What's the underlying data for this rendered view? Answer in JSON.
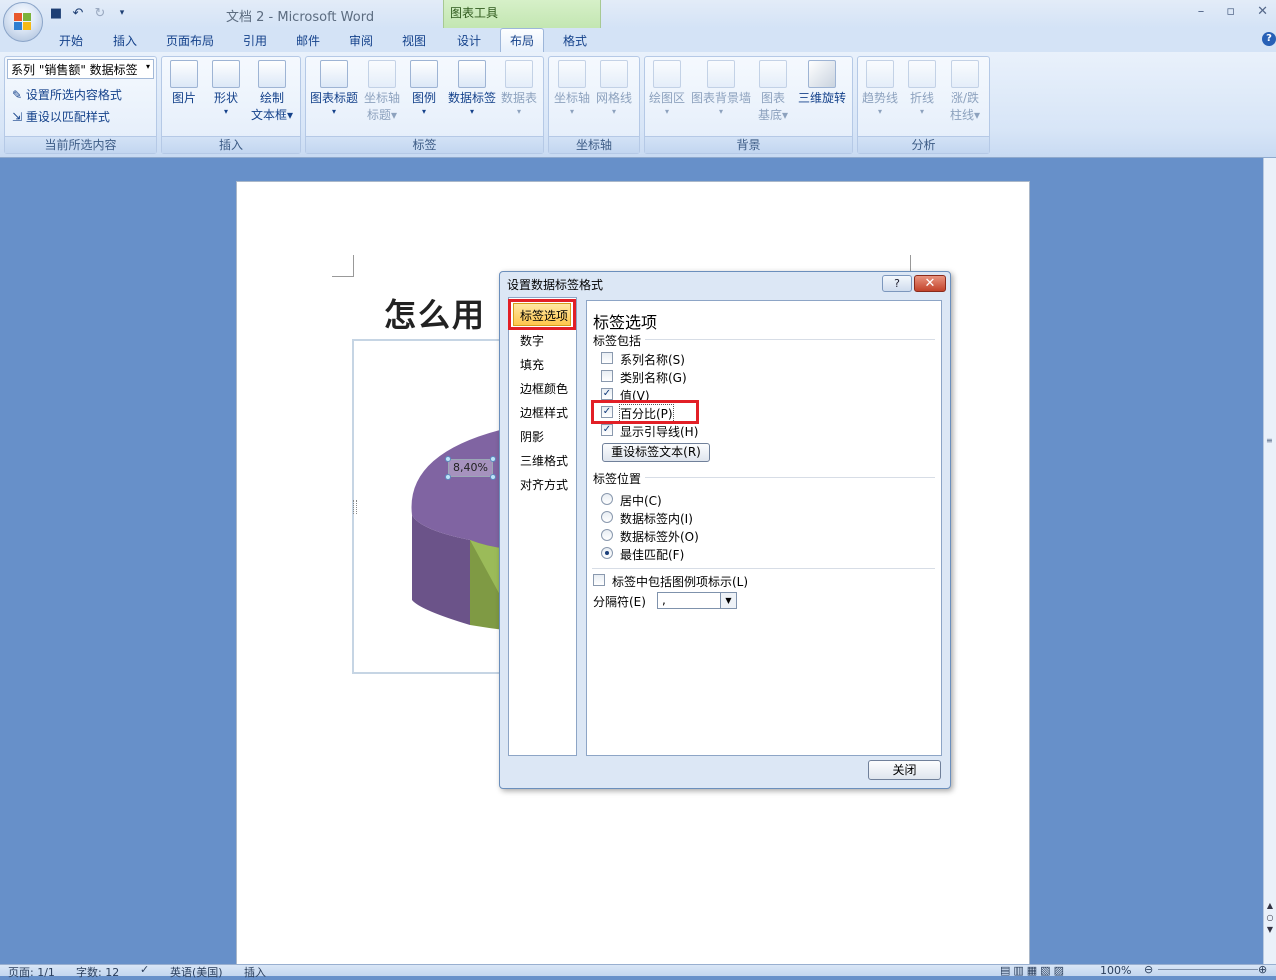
{
  "app": {
    "doc_title": "文档 2 - Microsoft Word",
    "contextual_tab": "图表工具"
  },
  "tabs": [
    "开始",
    "插入",
    "页面布局",
    "引用",
    "邮件",
    "审阅",
    "视图",
    "设计",
    "布局",
    "格式"
  ],
  "ribbon": {
    "current_selection": {
      "dropdown": "系列 \"销售额\" 数据标签",
      "format_sel": "设置所选内容格式",
      "reset": "重设以匹配样式",
      "label": "当前所选内容"
    },
    "insert": {
      "picture": "图片",
      "shapes": "形状",
      "textbox_1": "绘制",
      "textbox_2": "文本框",
      "label": "插入"
    },
    "labels": {
      "chart_title": "图表标题",
      "axis_title_1": "坐标轴",
      "axis_title_2": "标题",
      "legend": "图例",
      "data_labels": "数据标签",
      "data_table": "数据表",
      "label": "标签"
    },
    "axes": {
      "axes": "坐标轴",
      "gridlines": "网格线",
      "label": "坐标轴"
    },
    "background": {
      "plot_area": "绘图区",
      "wall": "图表背景墙",
      "floor_1": "图表",
      "floor_2": "基底",
      "rotation": "三维旋转",
      "label": "背景"
    },
    "analysis": {
      "trendline": "趋势线",
      "lines": "折线",
      "updown_1": "涨/跌",
      "updown_2": "柱线",
      "label": "分析"
    }
  },
  "document": {
    "heading": "怎么用",
    "data_label": "8,40%"
  },
  "dialog": {
    "title": "设置数据标签格式",
    "help": "?",
    "nav": [
      "标签选项",
      "数字",
      "填充",
      "边框颜色",
      "边框样式",
      "阴影",
      "三维格式",
      "对齐方式"
    ],
    "section_title": "标签选项",
    "contains_title": "标签包括",
    "options": [
      {
        "label": "系列名称(S)",
        "checked": false
      },
      {
        "label": "类别名称(G)",
        "checked": false
      },
      {
        "label": "值(V)",
        "checked": true
      },
      {
        "label": "百分比(P)",
        "checked": true
      },
      {
        "label": "显示引导线(H)",
        "checked": true
      }
    ],
    "reset_button": "重设标签文本(R)",
    "position_title": "标签位置",
    "positions": [
      {
        "label": "居中(C)",
        "selected": false
      },
      {
        "label": "数据标签内(I)",
        "selected": false
      },
      {
        "label": "数据标签外(O)",
        "selected": false
      },
      {
        "label": "最佳匹配(F)",
        "selected": true
      }
    ],
    "legend_key": "标签中包括图例项标示(L)",
    "separator_label": "分隔符(E)",
    "separator_value": ",",
    "close_button": "关闭"
  },
  "status": {
    "page": "页面: 1/1",
    "words": "字数: 12",
    "lang": "英语(美国)",
    "mode": "插入",
    "zoom": "100%"
  },
  "colors": {
    "highlight": "#e21f26",
    "pie_purple": "#8064a2",
    "pie_green": "#9bbb59"
  }
}
